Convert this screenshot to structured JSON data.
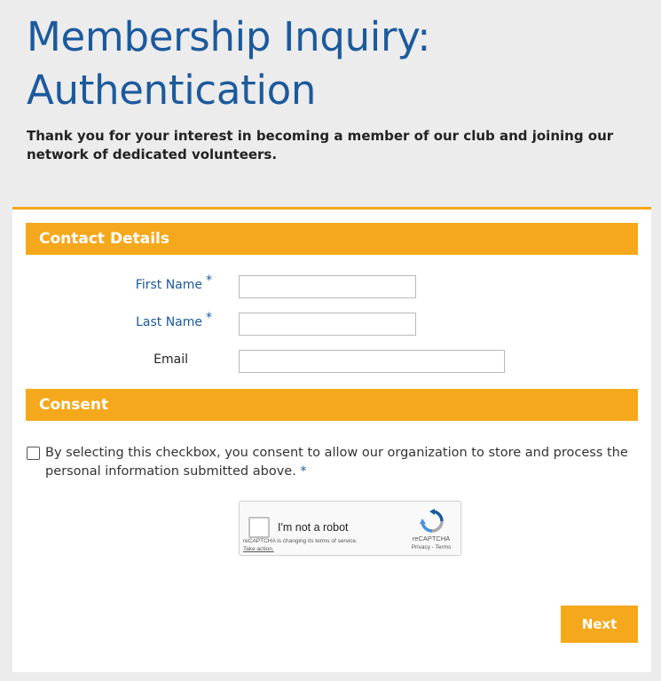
{
  "page": {
    "title": "Membership Inquiry: Authentication",
    "intro": "Thank you for your interest in becoming a member of our club and joining our network of dedicated volunteers."
  },
  "contact": {
    "heading": "Contact Details",
    "first_name_label": "First Name",
    "last_name_label": "Last Name",
    "email_label": "Email",
    "required_marker": "*",
    "first_name_value": "",
    "last_name_value": "",
    "email_value": ""
  },
  "consent": {
    "heading": "Consent",
    "text": "By selecting this checkbox, you consent to allow our organization to store and process the personal information submitted above.",
    "required_marker": "*",
    "checked": false
  },
  "recaptcha": {
    "label": "I'm not a robot",
    "notice": "reCAPTCHA is changing its terms of service.",
    "action": "Take action.",
    "brand": "reCAPTCHA",
    "links": "Privacy - Terms"
  },
  "actions": {
    "next_label": "Next"
  },
  "colors": {
    "accent": "#f5a81c",
    "title_blue": "#1c5a9c",
    "background": "#ececec"
  }
}
